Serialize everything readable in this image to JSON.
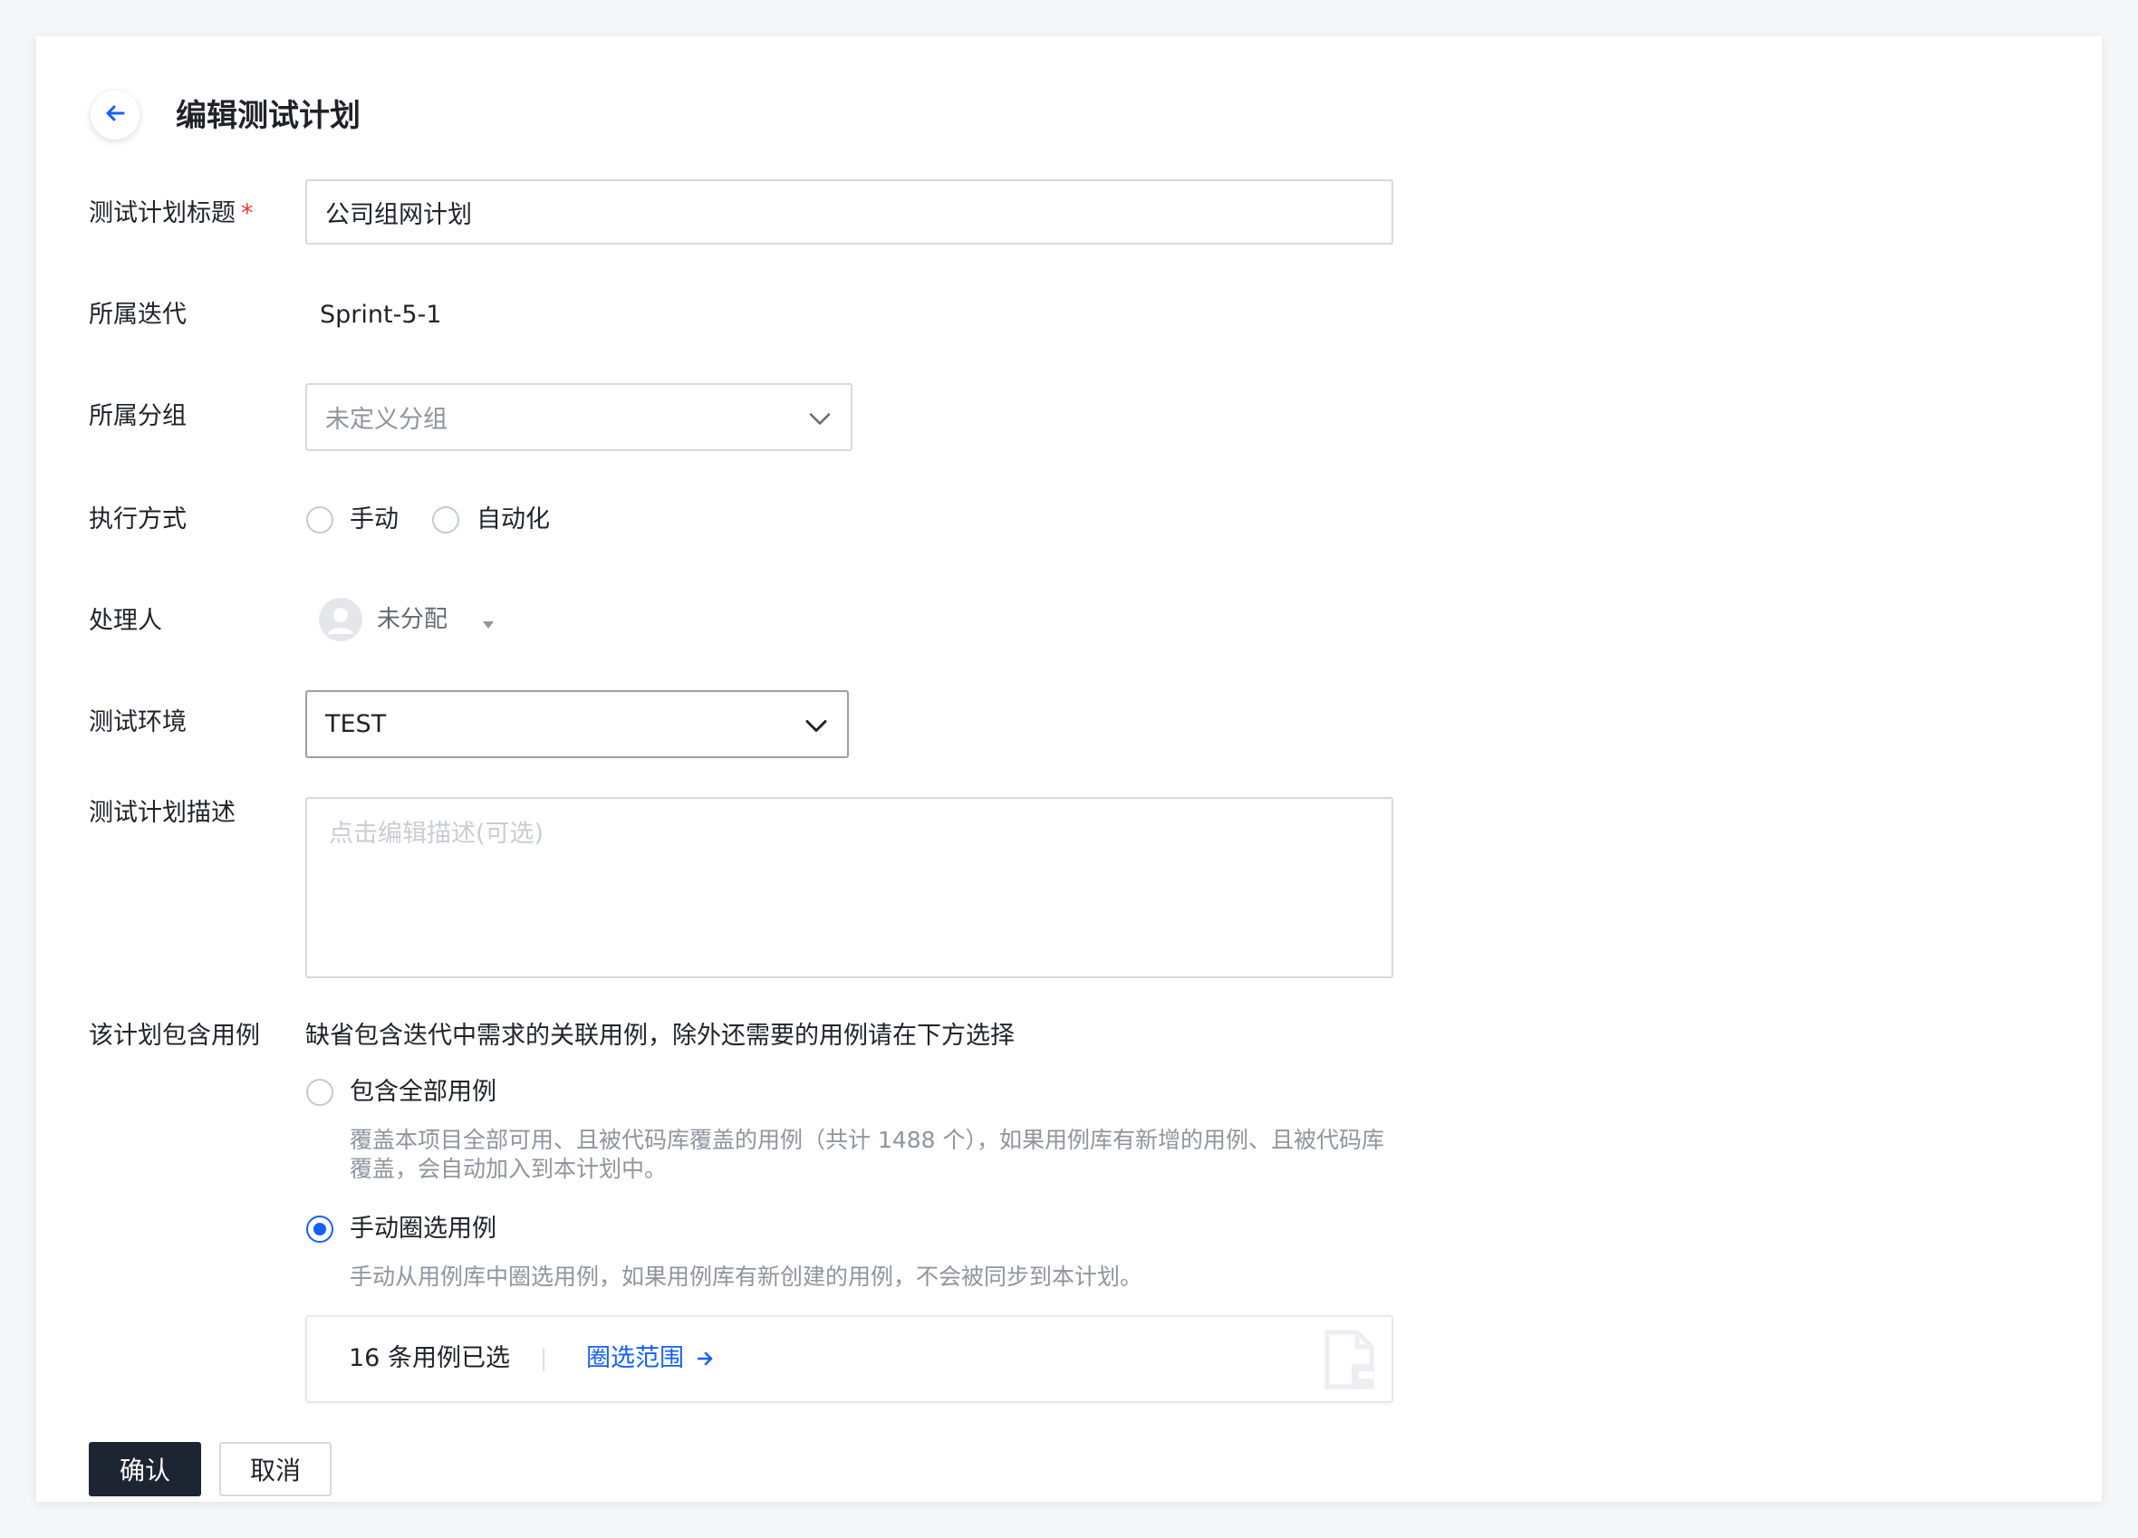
{
  "header": {
    "title": "编辑测试计划"
  },
  "form": {
    "title_label": "测试计划标题",
    "required_mark": "*",
    "title_value": "公司组网计划",
    "iteration_label": "所属迭代",
    "iteration_value": "Sprint-5-1",
    "group_label": "所属分组",
    "group_value": "未定义分组",
    "exec_label": "执行方式",
    "exec_options": [
      "手动",
      "自动化"
    ],
    "assignee_label": "处理人",
    "assignee_value": "未分配",
    "env_label": "测试环境",
    "env_value": "TEST",
    "desc_label": "测试计划描述",
    "desc_placeholder": "点击编辑描述(可选)",
    "cases_label": "该计划包含用例",
    "cases_hint": "缺省包含迭代中需求的关联用例，除外还需要的用例请在下方选择",
    "option_all_label": "包含全部用例",
    "option_all_desc": "覆盖本项目全部可用、且被代码库覆盖的用例（共计 1488 个），如果用例库有新增的用例、且被代码库覆盖，会自动加入到本计划中。",
    "option_manual_label": "手动圈选用例",
    "option_manual_desc": "手动从用例库中圈选用例，如果用例库有新创建的用例，不会被同步到本计划。",
    "selected_count_text": "16 条用例已选",
    "select_range_link": "圈选范围"
  },
  "actions": {
    "confirm": "确认",
    "cancel": "取消"
  },
  "colors": {
    "primary": "#1560f5",
    "dark_button": "#1d2432",
    "required": "#e53935"
  }
}
